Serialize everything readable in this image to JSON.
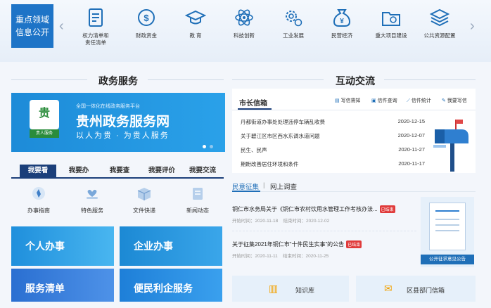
{
  "top": {
    "public_label": "重点领域\n信息公开",
    "categories": [
      {
        "label": "权力清单和\n责任清单",
        "icon": "list-document-icon"
      },
      {
        "label": "财政资金",
        "icon": "money-coin-icon"
      },
      {
        "label": "教 育",
        "icon": "graduation-cap-icon"
      },
      {
        "label": "科技创新",
        "icon": "atom-icon"
      },
      {
        "label": "工业发展",
        "icon": "gears-icon"
      },
      {
        "label": "民营经济",
        "icon": "money-bag-icon"
      },
      {
        "label": "重大项目建设",
        "icon": "construction-folder-icon"
      },
      {
        "label": "公共资源配置",
        "icon": "layers-icon"
      }
    ]
  },
  "gov": {
    "title": "政务服务",
    "banner_sub": "全国一体化在线政务服务平台",
    "banner_title": "贵州政务服务网",
    "banner_slogan": "以人为贵 · 为贵人服务",
    "banner_logo_text": "贵人服务",
    "tabs": [
      "我要看",
      "我要办",
      "我要查",
      "我要评价",
      "我要交流"
    ],
    "services": [
      {
        "label": "办事指南",
        "icon": "compass-icon"
      },
      {
        "label": "特色服务",
        "icon": "hands-heart-icon"
      },
      {
        "label": "文件快递",
        "icon": "box-icon"
      },
      {
        "label": "新闻动态",
        "icon": "news-icon"
      }
    ],
    "tiles": [
      "个人办事",
      "企业办事",
      "服务清单",
      "便民利企服务"
    ]
  },
  "interact": {
    "title": "互动交流",
    "mayor_tab": "市长信箱",
    "actions": [
      "写信需知",
      "信件查询",
      "信件统计",
      "我要写信"
    ],
    "letters": [
      {
        "title": "丹都街道办事处处理违停车辆乱收费",
        "date": "2020-12-15"
      },
      {
        "title": "关于碧江区市区西水东调水道问题",
        "date": "2020-12-07"
      },
      {
        "title": "民生、民声",
        "date": "2020-11-27"
      },
      {
        "title": "期盼改善居住环境和条件",
        "date": "2020-11-17"
      }
    ],
    "notice_tabs": [
      "民意征集",
      "网上调查"
    ],
    "notices": [
      {
        "title": "铜仁市水务局关于《铜仁市农村饮用水管理工作考核办法...",
        "badge": "已结束",
        "start_label": "开始时间：",
        "start": "2020-11-18",
        "end_label": "结束时间：",
        "end": "2020-12-02"
      },
      {
        "title": "关于征集2021年铜仁市“十件民生实事”的公告",
        "badge": "已结束",
        "start_label": "开始时间：",
        "start": "2020-11-11",
        "end_label": "结束时间：",
        "end": "2020-11-25"
      }
    ],
    "side_card": "公开征求意见公告",
    "bottom": [
      "知识库",
      "区县部门信箱"
    ]
  }
}
